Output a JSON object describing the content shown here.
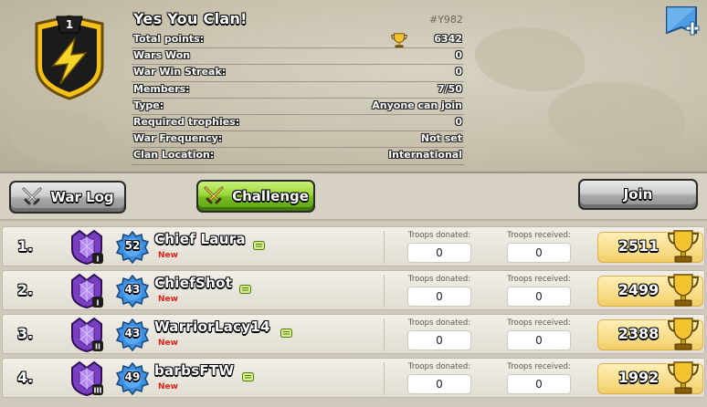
{
  "clan": {
    "rank": "1",
    "name": "Yes You Clan!",
    "tag": "#Y982"
  },
  "stats": [
    {
      "label": "Total points:",
      "value": "6342"
    },
    {
      "label": "Wars Won",
      "value": "0"
    },
    {
      "label": "War Win Streak:",
      "value": "0"
    },
    {
      "label": "Members:",
      "value": "7/50"
    },
    {
      "label": "Type:",
      "value": "Anyone can join"
    },
    {
      "label": "Required trophies:",
      "value": "0"
    },
    {
      "label": "War Frequency:",
      "value": "Not set"
    },
    {
      "label": "Clan Location:",
      "value": "International"
    }
  ],
  "buttons": {
    "war_log": "War Log",
    "challenge": "Challenge",
    "join": "Join"
  },
  "members": [
    {
      "rank": "1.",
      "name": "Chief Laura",
      "role": "New",
      "level": "52",
      "league_tier": "I",
      "donated_label": "Troops donated:",
      "donated": "0",
      "received_label": "Troops received:",
      "received": "0",
      "trophies": "2511"
    },
    {
      "rank": "2.",
      "name": "ChiefShot",
      "role": "New",
      "level": "43",
      "league_tier": "I",
      "donated_label": "Troops donated:",
      "donated": "0",
      "received_label": "Troops received:",
      "received": "0",
      "trophies": "2499"
    },
    {
      "rank": "3.",
      "name": "WarriorLacy14",
      "role": "New",
      "level": "43",
      "league_tier": "II",
      "donated_label": "Troops donated:",
      "donated": "0",
      "received_label": "Troops received:",
      "received": "0",
      "trophies": "2388"
    },
    {
      "rank": "4.",
      "name": "barbsFTW",
      "role": "New",
      "level": "49",
      "league_tier": "III",
      "donated_label": "Troops donated:",
      "donated": "0",
      "received_label": "Troops received:",
      "received": "0",
      "trophies": "1992"
    }
  ],
  "colors": {
    "green_button": "#74bb1f",
    "gray_button": "#a9a9a9",
    "trophy_gold": "#f3cf68",
    "role_red": "#e0231a",
    "league_purple": "#7b3fc4",
    "xp_blue": "#3d8fe0"
  },
  "icons": {
    "clan_badge": "lightning-shield-icon",
    "trophy": "trophy-icon",
    "war_log": "crossed-swords-icon",
    "challenge": "crossed-swords-icon",
    "league": "crystal-league-icon",
    "xp": "xp-star-icon",
    "chat": "chat-bubble-icon",
    "corner": "flag-plus-icon"
  }
}
